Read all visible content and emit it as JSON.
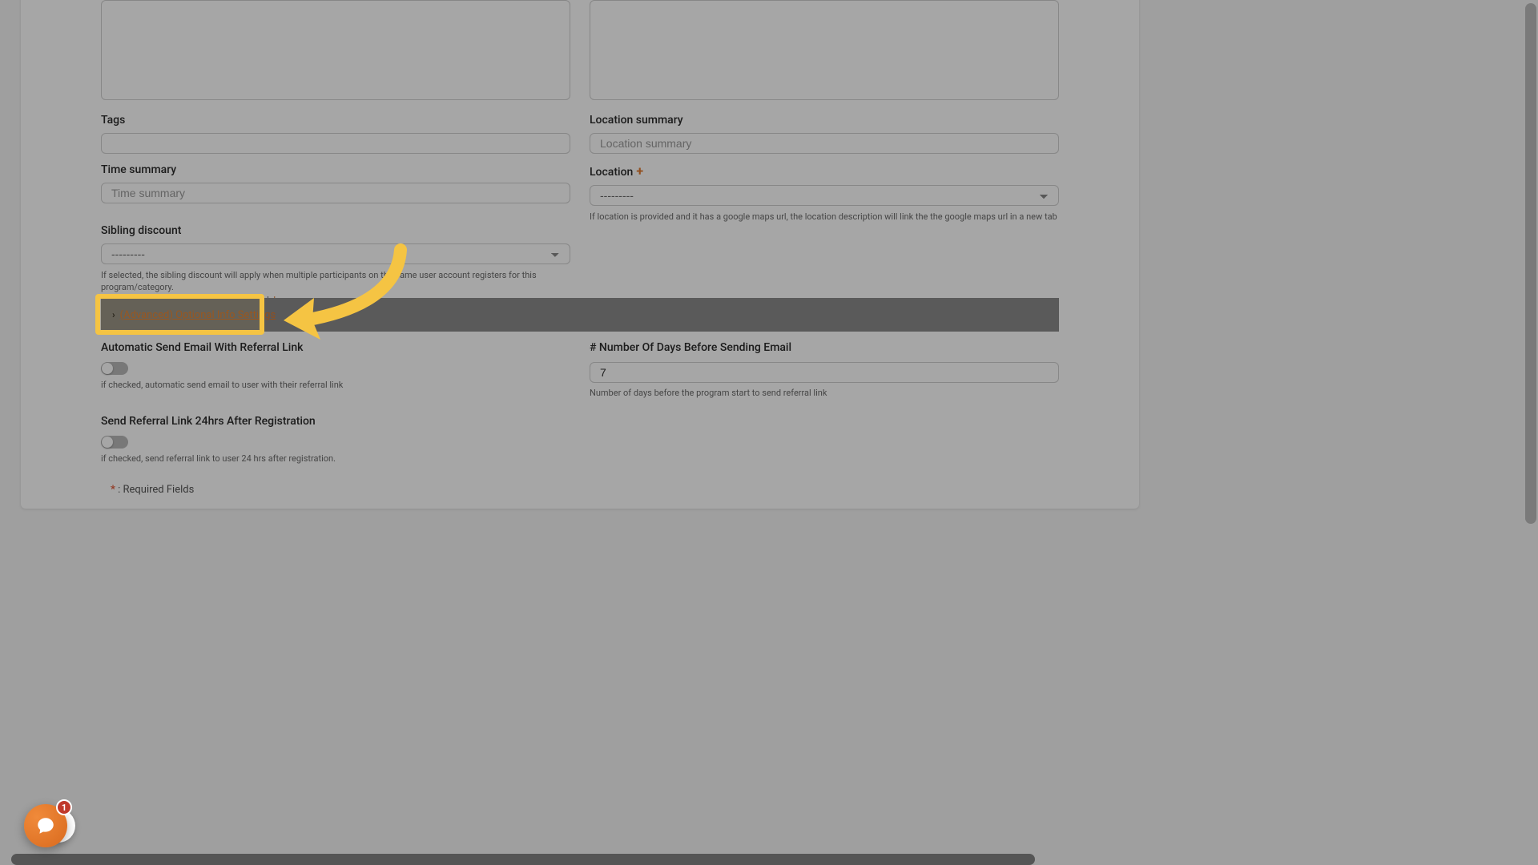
{
  "labels": {
    "tags": "Tags",
    "location_summary": "Location summary",
    "time_summary": "Time summary",
    "location": "Location",
    "sibling_discount": "Sibling discount",
    "auto_email": "Automatic Send Email With Referral Link",
    "num_days": "# Number Of Days Before Sending Email",
    "send_24h": "Send Referral Link 24hrs After Registration"
  },
  "placeholders": {
    "location_summary": "Location summary",
    "time_summary": "Time summary"
  },
  "selects": {
    "location_placeholder": "---------",
    "sibling_placeholder": "---------"
  },
  "help": {
    "location": "If location is provided and it has a google maps url, the location description will link the the google maps url in a new tab",
    "sibling_main": "If selected, the sibling discount will apply when multiple participants on the same user account registers for this program/category.",
    "sibling_create": "To create or modify a Sibling Discount, click ",
    "sibling_link": "here",
    "auto_email": "if checked, automatic send email to user with their referral link",
    "num_days": "Number of days before the program start to send referral link",
    "send_24h": "if checked, send referral link to user 24 hrs after registration."
  },
  "collapsible": {
    "label": "(Advanced) Optional Info Settings"
  },
  "values": {
    "num_days": "7"
  },
  "required_note": {
    "star": "*",
    "text": " : Required Fields"
  },
  "chat": {
    "count": "1"
  }
}
